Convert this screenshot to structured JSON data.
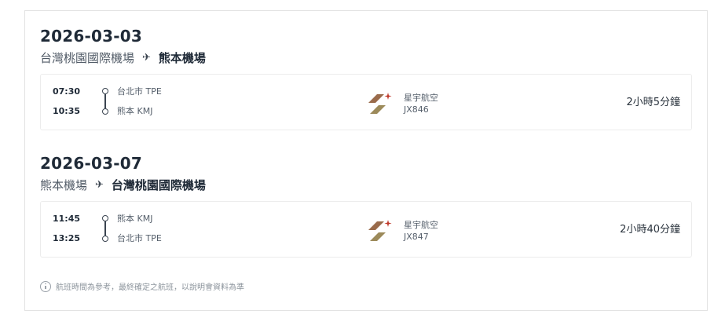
{
  "itinerary": {
    "legs": [
      {
        "date": "2026-03-03",
        "route_from": "台灣桃園國際機場",
        "route_to": "熊本機場",
        "flight": {
          "depart_time": "07:30",
          "arrive_time": "10:35",
          "depart_city": "台北市 TPE",
          "arrive_city": "熊本 KMJ",
          "airline_name": "星宇航空",
          "flight_number": "JX846",
          "duration": "2小時5分鐘"
        }
      },
      {
        "date": "2026-03-07",
        "route_from": "熊本機場",
        "route_to": "台灣桃園國際機場",
        "flight": {
          "depart_time": "11:45",
          "arrive_time": "13:25",
          "depart_city": "熊本 KMJ",
          "arrive_city": "台北市 TPE",
          "airline_name": "星宇航空",
          "flight_number": "JX847",
          "duration": "2小時40分鐘"
        }
      }
    ],
    "note": "航班時間為參考，最終確定之航班，以說明會資料為準"
  },
  "icons": {
    "route_arrow": "airplane-icon",
    "info": "info-icon",
    "airline_logo": "starlux-logo"
  },
  "colors": {
    "text_primary": "#1f2a37",
    "text_secondary": "#555f6b",
    "logo_copper": "#9a6b4b",
    "logo_gold": "#9c8a5a",
    "logo_star": "#c0392b"
  }
}
